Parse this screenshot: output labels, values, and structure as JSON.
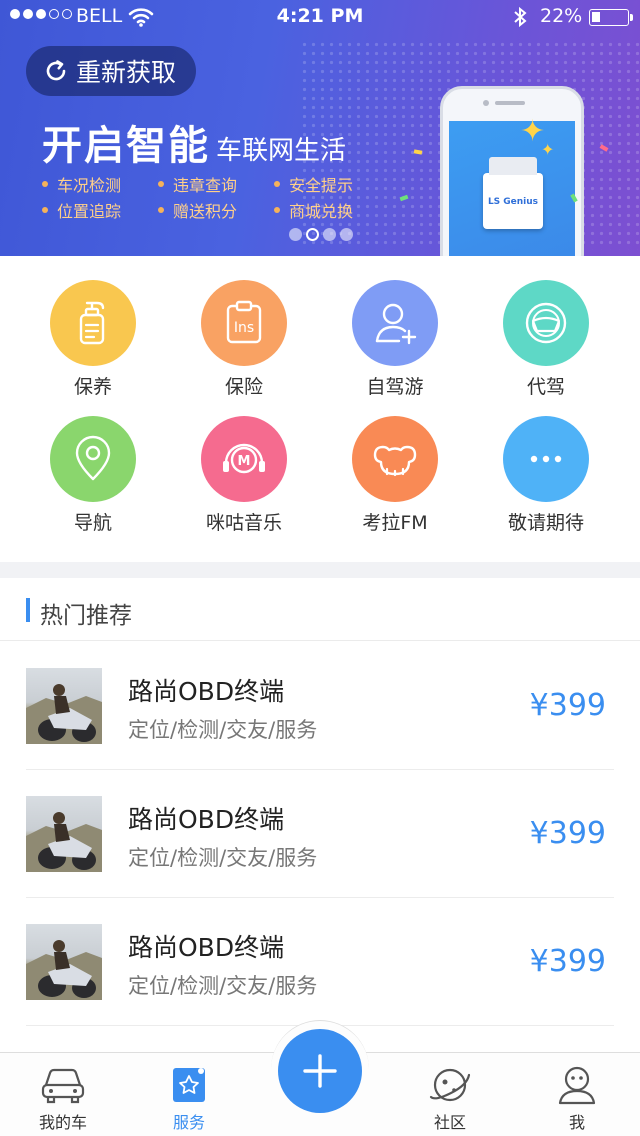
{
  "status_bar": {
    "carrier": "BELL",
    "time": "4:21 PM",
    "battery": "22%",
    "battery_level": 0.22,
    "signal_bars_filled": 3
  },
  "banner": {
    "refresh_label": "重新获取",
    "title_big": "开启智能",
    "title_small": "车联网生活",
    "features": [
      "车况检测",
      "违章查询",
      "安全提示",
      "位置追踪",
      "赠送积分",
      "商城兑换"
    ],
    "device_label": "LS Genius",
    "active_page": 2,
    "page_count": 4
  },
  "services": [
    {
      "label": "保养",
      "icon": "sanitizer-bottle-icon",
      "color": "#f9c74f"
    },
    {
      "label": "保险",
      "icon": "insurance-clipboard-icon",
      "color": "#f9a263"
    },
    {
      "label": "自驾游",
      "icon": "add-person-icon",
      "color": "#7f9cf5"
    },
    {
      "label": "代驾",
      "icon": "steering-wheel-icon",
      "color": "#5ed8c6"
    },
    {
      "label": "导航",
      "icon": "location-pin-icon",
      "color": "#8ad66d"
    },
    {
      "label": "咪咕音乐",
      "icon": "music-headphones-icon",
      "color": "#f56b8f"
    },
    {
      "label": "考拉FM",
      "icon": "koala-icon",
      "color": "#f98a55"
    },
    {
      "label": "敬请期待",
      "icon": "more-dots-icon",
      "color": "#4fb2f7"
    }
  ],
  "hot": {
    "title": "热门推荐",
    "products": [
      {
        "name": "路尚OBD终端",
        "desc": "定位/检测/交友/服务",
        "price": "¥399"
      },
      {
        "name": "路尚OBD终端",
        "desc": "定位/检测/交友/服务",
        "price": "¥399"
      },
      {
        "name": "路尚OBD终端",
        "desc": "定位/检测/交友/服务",
        "price": "¥399"
      }
    ]
  },
  "tabbar": {
    "tabs": [
      {
        "label": "我的车",
        "icon": "car-icon"
      },
      {
        "label": "服务",
        "icon": "service-ticket-icon"
      },
      {
        "label": "社区",
        "icon": "planet-icon"
      },
      {
        "label": "我",
        "icon": "profile-icon"
      }
    ],
    "active": "服务",
    "fab_icon": "plus-icon",
    "accent": "#3a8ef0"
  }
}
